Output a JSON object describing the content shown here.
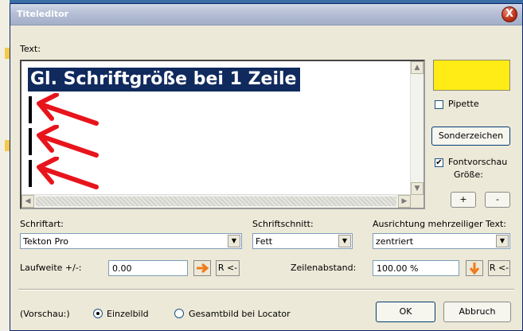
{
  "window": {
    "title": "Titeleditor",
    "close_glyph": "X"
  },
  "text_section": {
    "label": "Text:",
    "line1": "Gl. Schriftgröße bei  1 Zeile",
    "annotation_icon": "red-arrow-icon",
    "annotation_color": "#e8141c"
  },
  "right_panel": {
    "color_value": "#ffeb16",
    "pipette_label": "Pipette",
    "pipette_checked": false,
    "special_chars_label": "Sonderzeichen",
    "font_preview_label": "Fontvorschau",
    "font_preview_checked": true,
    "size_label": "Größe:",
    "plus_label": "+",
    "minus_label": "-"
  },
  "font": {
    "label": "Schriftart:",
    "value": "Tekton Pro",
    "style_label": "Schriftschnitt:",
    "style_value": "Fett",
    "align_label": "Ausrichtung mehrzeiliger Text:",
    "align_value": "zentriert"
  },
  "spacing": {
    "laufweite_label": "Laufweite +/-:",
    "laufweite_value": "0.00",
    "reset_label": "R <-",
    "line_spacing_label": "Zeilenabstand:",
    "line_spacing_value": "100.00 %",
    "arrow_color": "#f07a1a"
  },
  "preview": {
    "label": "(Vorschau:)",
    "option1": "Einzelbild",
    "option1_selected": true,
    "option2": "Gesamtbild bei Locator"
  },
  "buttons": {
    "ok": "OK",
    "cancel": "Abbruch"
  }
}
